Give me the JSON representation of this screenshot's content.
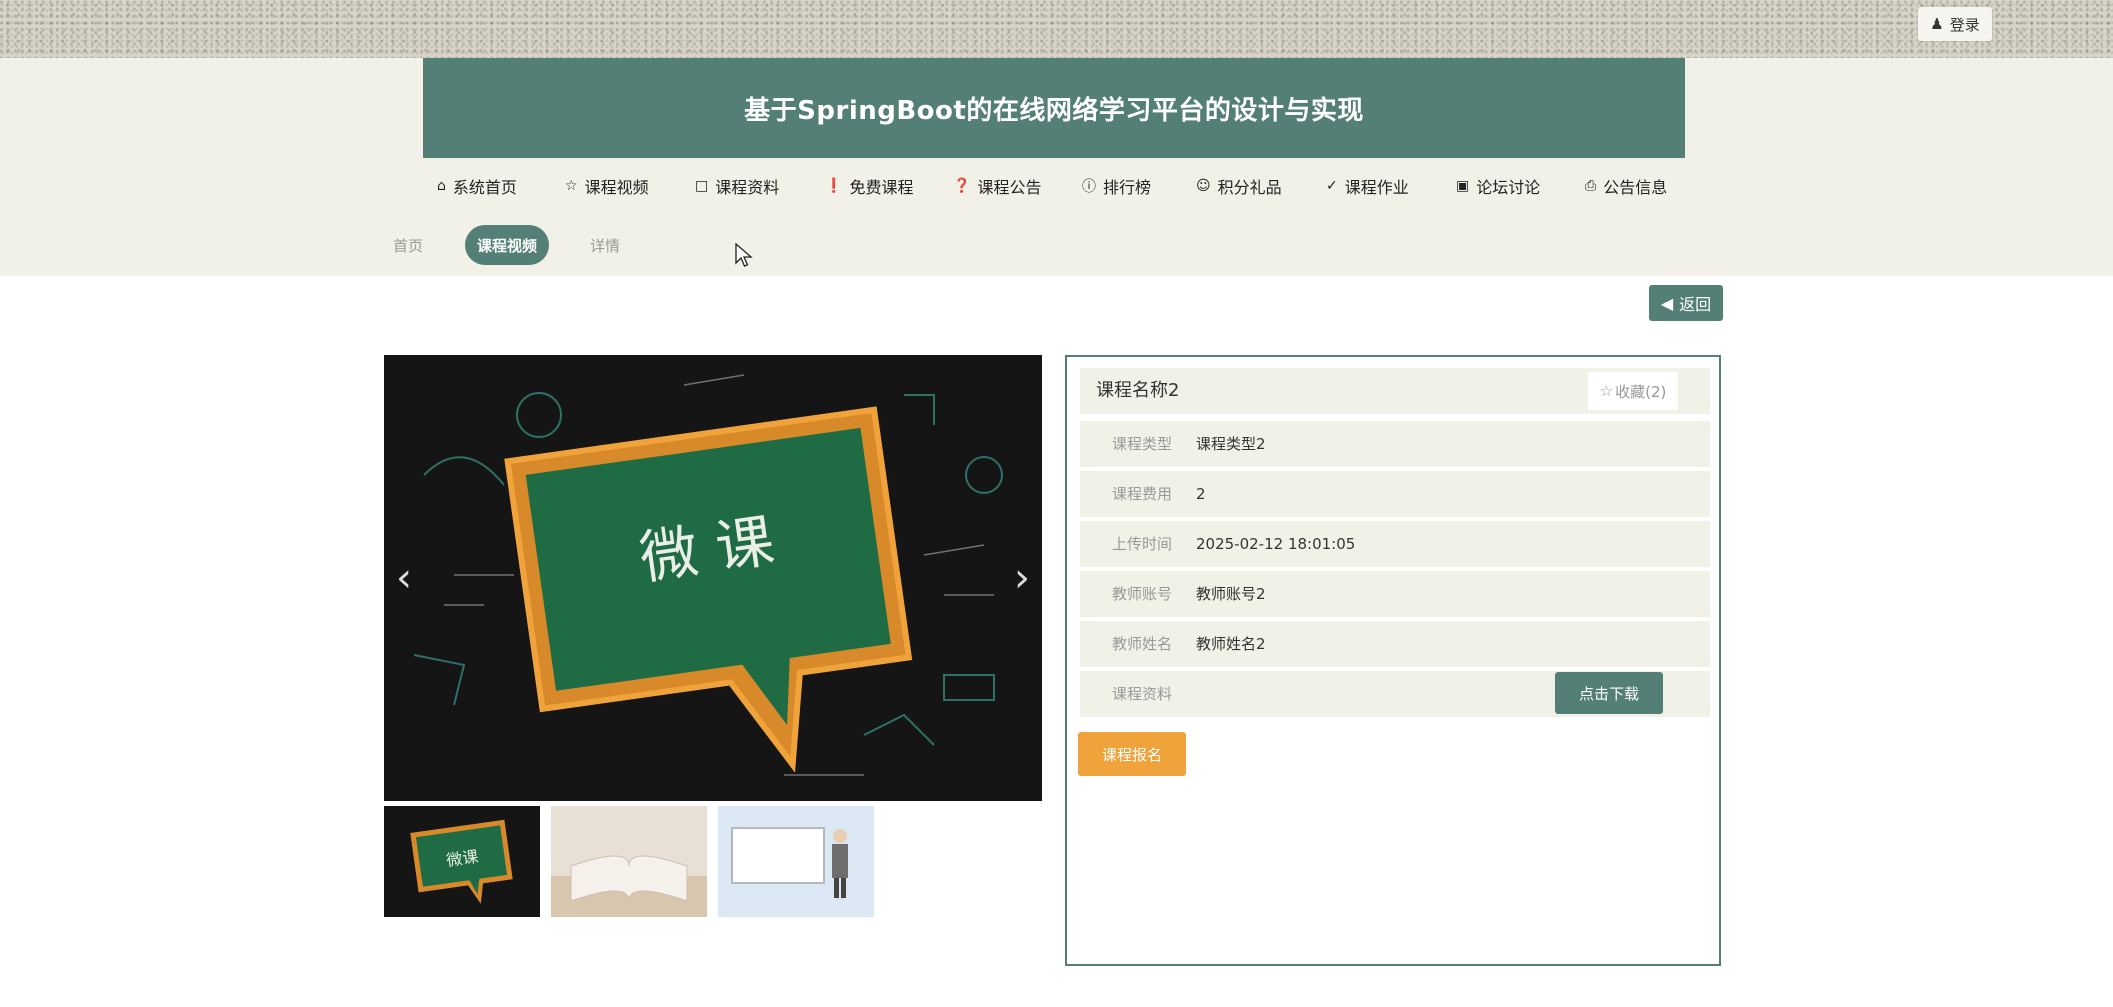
{
  "header": {
    "login_label": "登录",
    "site_title": "基于SpringBoot的在线网络学习平台的设计与实现"
  },
  "nav": {
    "items": [
      {
        "label": "系统首页",
        "icon": "home-icon"
      },
      {
        "label": "课程视频",
        "icon": "star-icon"
      },
      {
        "label": "课程资料",
        "icon": "bag-icon"
      },
      {
        "label": "免费课程",
        "icon": "alert-icon"
      },
      {
        "label": "课程公告",
        "icon": "question-icon"
      },
      {
        "label": "排行榜",
        "icon": "info-icon"
      },
      {
        "label": "积分礼品",
        "icon": "smile-icon"
      },
      {
        "label": "课程作业",
        "icon": "check-icon"
      },
      {
        "label": "论坛讨论",
        "icon": "camera-icon"
      },
      {
        "label": "公告信息",
        "icon": "print-icon"
      }
    ]
  },
  "breadcrumb": {
    "home": "首页",
    "current": "课程视频",
    "detail": "详情"
  },
  "actions": {
    "back_label": "返回",
    "download_label": "点击下载",
    "enroll_label": "课程报名"
  },
  "gallery": {
    "main_image": "chalkboard-speech-bubble",
    "main_text": "微 课",
    "thumb_text": "微课"
  },
  "course": {
    "name": "课程名称2",
    "favorite_label": "收藏(2)",
    "fields": [
      {
        "label": "课程类型",
        "value": "课程类型2"
      },
      {
        "label": "课程费用",
        "value": "2"
      },
      {
        "label": "上传时间",
        "value": "2025-02-12 18:01:05"
      },
      {
        "label": "教师账号",
        "value": "教师账号2"
      },
      {
        "label": "教师姓名",
        "value": "教师姓名2"
      },
      {
        "label": "课程资料",
        "value": ""
      }
    ]
  },
  "colors": {
    "primary": "#537f76",
    "header_bg": "#f2f1e8",
    "accent_orange": "#f0a33a"
  }
}
